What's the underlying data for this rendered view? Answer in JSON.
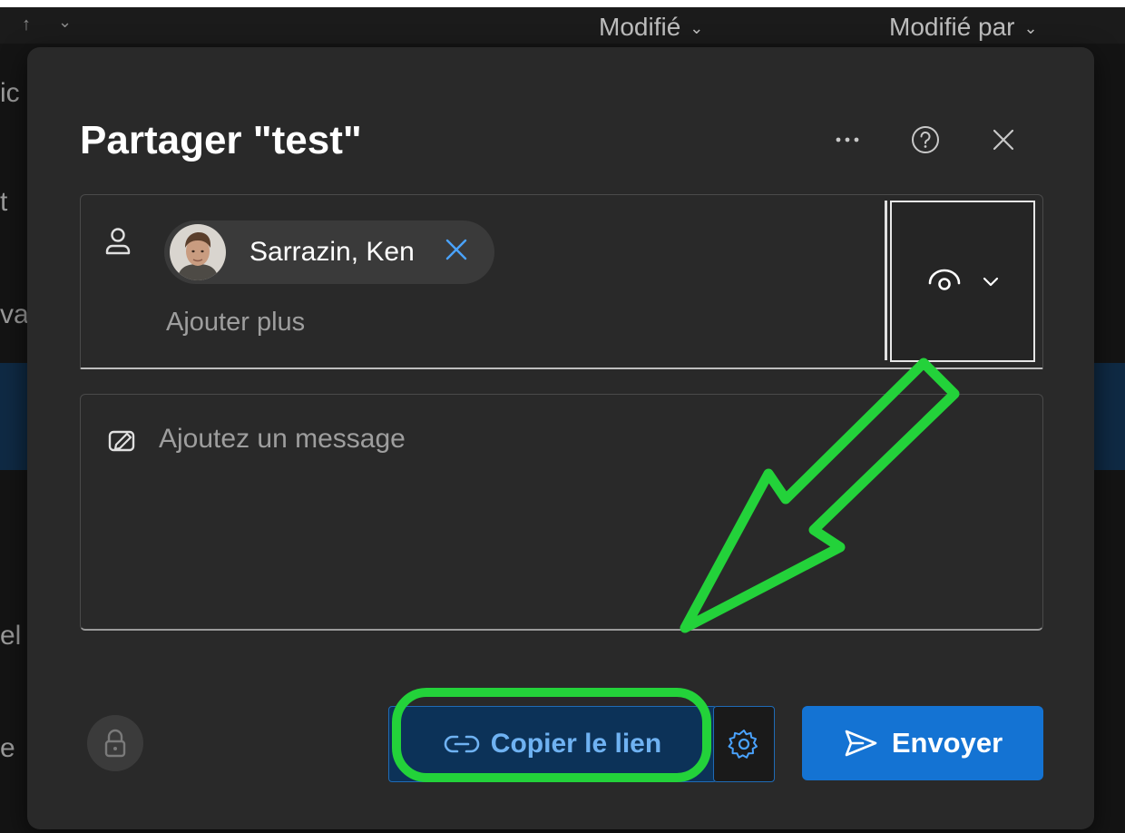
{
  "background": {
    "columns": [
      {
        "label": "Modifié"
      },
      {
        "label": "Modifié par"
      }
    ],
    "edge_fragments": [
      "ic",
      "t",
      "va",
      "el",
      "e"
    ]
  },
  "dialog": {
    "title": "Partager \"test\"",
    "header_icons": [
      "more-icon",
      "help-icon",
      "close-icon"
    ],
    "recipients": [
      {
        "name": "Sarrazin, Ken"
      }
    ],
    "add_more_placeholder": "Ajouter plus",
    "permission": {
      "icon": "eye-icon"
    },
    "message_placeholder": "Ajoutez un message",
    "footer": {
      "copy_link_label": "Copier le lien",
      "send_label": "Envoyer"
    }
  },
  "colors": {
    "accent": "#1473d3",
    "copy_link_text": "#6fb2f2",
    "annotation": "#23d23a"
  }
}
